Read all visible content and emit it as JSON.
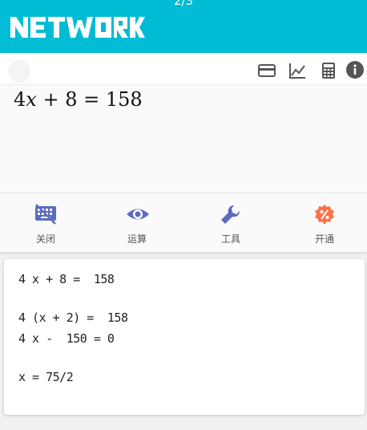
{
  "header": {
    "page_indicator": "2/3",
    "logo_text": "NETWORK",
    "color": "#00bcd4"
  },
  "toolbar": {
    "icons": [
      "card-icon",
      "chart-line-icon",
      "calculator-icon",
      "info-icon"
    ]
  },
  "equation": {
    "coefficient": "4",
    "variable": "x",
    "rest": " + 8 = 158"
  },
  "actions": [
    {
      "label": "关闭",
      "icon": "keyboard-icon",
      "color": "#5c6bc0"
    },
    {
      "label": "运算",
      "icon": "eye-icon",
      "color": "#5c6bc0"
    },
    {
      "label": "工具",
      "icon": "wrench-icon",
      "color": "#5c6bc0"
    },
    {
      "label": "开通",
      "icon": "badge-percent-icon",
      "color": "#ff7043"
    }
  ],
  "solution": {
    "steps": [
      "4 x + 8 =  158",
      "4 (x + 2) =  158",
      "4 x -  150 = 0",
      "x = 75/2"
    ]
  }
}
